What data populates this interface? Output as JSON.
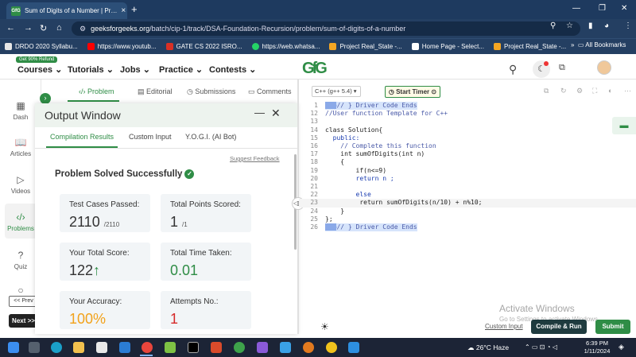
{
  "browser": {
    "tab_title": "Sum of Digits of a Number | Pr…",
    "tab_favicon": "GfG",
    "url_domain": "geeksforgeeks.org",
    "url_path": "/batch/cip-1/track/DSA-Foundation-Recursion/problem/sum-of-digits-of-a-number",
    "bookmarks": [
      {
        "label": "DRDO 2020 Syllabu...",
        "color": "#e6e6e6"
      },
      {
        "label": "https://www.youtub...",
        "color": "#ff0000"
      },
      {
        "label": "GATE CS 2022 ISRO...",
        "color": "#d93025"
      },
      {
        "label": "https://web.whatsa...",
        "color": "#25d366"
      },
      {
        "label": "Project Real_State -...",
        "color": "#f4a623"
      },
      {
        "label": "Home Page - Select...",
        "color": "#ffffff"
      },
      {
        "label": "Project Real_State -...",
        "color": "#f4a623"
      }
    ],
    "all_bookmarks": "All Bookmarks"
  },
  "site": {
    "refund_badge": "Get 90% Refund",
    "menu": [
      "Courses ⌄",
      "Tutorials ⌄",
      "Jobs ⌄",
      "Practice ⌄",
      "Contests ⌄"
    ],
    "logo": "GfG",
    "brand_color": "#2f8d46"
  },
  "sidebar": {
    "items": [
      "Dash",
      "Articles",
      "Videos",
      "Problems",
      "Quiz"
    ],
    "prev": "<< Prev",
    "next": "Next >>"
  },
  "problem_tabs": [
    "Problem",
    "Editorial",
    "Submissions",
    "Comments"
  ],
  "output_window": {
    "title": "Output Window",
    "tabs": [
      "Compilation Results",
      "Custom Input",
      "Y.O.G.I. (AI Bot)"
    ],
    "suggest_feedback": "Suggest Feedback",
    "status": "Problem Solved Successfully",
    "cards": [
      {
        "label": "Test Cases Passed:",
        "value": "2110",
        "sub": "/2110"
      },
      {
        "label": "Total Points Scored:",
        "value": "1",
        "sub": "/1"
      },
      {
        "label": "Your Total Score:",
        "value": "122",
        "sub": "↑"
      },
      {
        "label": "Total Time Taken:",
        "value": "0.01",
        "sub": ""
      },
      {
        "label": "Your Accuracy:",
        "value": "100%",
        "sub": ""
      },
      {
        "label": "Attempts No.:",
        "value": "1",
        "sub": ""
      }
    ]
  },
  "editor": {
    "language": "C++ (g++ 5.4)",
    "timer": "Start Timer",
    "lines": [
      {
        "n": "1",
        "text": "// } Driver Code Ends"
      },
      {
        "n": "12",
        "text": "//User function Template for C++"
      },
      {
        "n": "13",
        "text": ""
      },
      {
        "n": "14",
        "text": "class Solution{"
      },
      {
        "n": "15",
        "text": "  public:"
      },
      {
        "n": "16",
        "text": "    // Complete this function"
      },
      {
        "n": "17",
        "text": "    int sumOfDigits(int n)"
      },
      {
        "n": "18",
        "text": "    {"
      },
      {
        "n": "19",
        "text": "        if(n<=9)"
      },
      {
        "n": "20",
        "text": "        return n ;"
      },
      {
        "n": "21",
        "text": ""
      },
      {
        "n": "22",
        "text": "        else"
      },
      {
        "n": "23",
        "text": "         return sumOfDigits(n/10) + n%10;"
      },
      {
        "n": "24",
        "text": "    }"
      },
      {
        "n": "25",
        "text": "};"
      },
      {
        "n": "26",
        "text": "// } Driver Code Ends"
      }
    ],
    "watermark_title": "Activate Windows",
    "watermark_sub": "Go to Settings to activate Windows.",
    "custom_input": "Custom Input",
    "compile_run": "Compile & Run",
    "submit": "Submit"
  },
  "taskbar": {
    "weather": "26°C  Haze",
    "time": "6:39 PM",
    "date": "1/11/2024"
  }
}
